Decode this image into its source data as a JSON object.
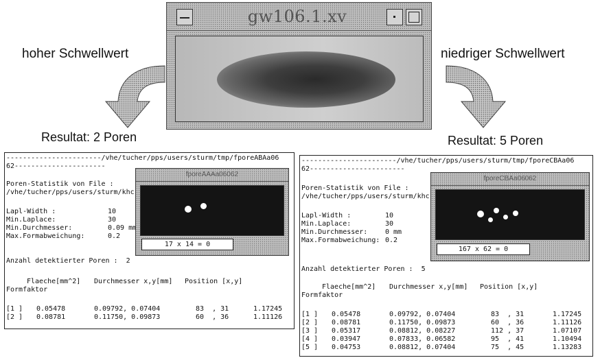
{
  "top_window": {
    "title": "gw106.1.xv"
  },
  "labels": {
    "left_arrow": "hoher Schwellwert",
    "right_arrow": "niedriger Schwellwert",
    "left_result": "Resultat: 2 Poren",
    "right_result": "Resultat: 5 Poren"
  },
  "left_panel": {
    "path_line": "-----------------------/vhe/tucher/pps/users/sturm/tmp/fporeABAa06",
    "path_line2": "62----------------------",
    "stat_title": "Poren-Statistik von File :",
    "stat_path": "/vhe/tucher/pps/users/sturm/khc",
    "params": [
      {
        "name": "Lapl-Width :",
        "value": "10"
      },
      {
        "name": "Min.Laplace:",
        "value": "30"
      },
      {
        "name": "Min.Durchmesser:",
        "value": "0.09 mm"
      },
      {
        "name": "Max.Formabweichung:",
        "value": "0.2"
      }
    ],
    "count_line": "Anzahl detektierter Poren :  2",
    "table_headers": {
      "flaeche": "Flaeche[mm^2]",
      "durchmesser": "Durchmesser x,y[mm]",
      "position": "Position [x,y]",
      "formfaktor": "Formfaktor"
    },
    "rows": [
      {
        "idx": "[1 ]",
        "flaeche": "0.05478",
        "durchmesser": "0.09792, 0.07404",
        "position": "83  , 31",
        "formfaktor": "1.17245"
      },
      {
        "idx": "[2 ]",
        "flaeche": "0.08781",
        "durchmesser": "0.11750, 0.09873",
        "position": "60  , 36",
        "formfaktor": "1.11126"
      }
    ],
    "subwindow": {
      "title": "fporeAAAa06062",
      "readout": "17 x  14  =    0"
    }
  },
  "right_panel": {
    "path_line": "-----------------------/vhe/tucher/pps/users/sturm/tmp/fporeCBAa06",
    "path_line2": "62-----------------------",
    "stat_title": "Poren-Statistik von File :",
    "stat_path": "/vhe/tucher/pps/users/sturm/khc",
    "params": [
      {
        "name": "Lapl-Width :",
        "value": "10"
      },
      {
        "name": "Min.Laplace:",
        "value": "30"
      },
      {
        "name": "Min.Durchmesser:",
        "value": "0 mm"
      },
      {
        "name": "Max.Formabweichung:",
        "value": "0.2"
      }
    ],
    "count_line": "Anzahl detektierter Poren :  5",
    "table_headers": {
      "flaeche": "Flaeche[mm^2]",
      "durchmesser": "Durchmesser x,y[mm]",
      "position": "Position [x,y]",
      "formfaktor": "Formfaktor"
    },
    "rows": [
      {
        "idx": "[1 ]",
        "flaeche": "0.05478",
        "durchmesser": "0.09792, 0.07404",
        "position": "83  , 31",
        "formfaktor": "1.17245"
      },
      {
        "idx": "[2 ]",
        "flaeche": "0.08781",
        "durchmesser": "0.11750, 0.09873",
        "position": "60  , 36",
        "formfaktor": "1.11126"
      },
      {
        "idx": "[3 ]",
        "flaeche": "0.05317",
        "durchmesser": "0.08812, 0.08227",
        "position": "112 , 37",
        "formfaktor": "1.07107"
      },
      {
        "idx": "[4 ]",
        "flaeche": "0.03947",
        "durchmesser": "0.07833, 0.06582",
        "position": "95  , 41",
        "formfaktor": "1.10494"
      },
      {
        "idx": "[5 ]",
        "flaeche": "0.04753",
        "durchmesser": "0.08812, 0.07404",
        "position": "75  , 45",
        "formfaktor": "1.13283"
      }
    ],
    "subwindow": {
      "title": "fporeCBAa06062",
      "readout": "167 x  62  =    0"
    }
  }
}
